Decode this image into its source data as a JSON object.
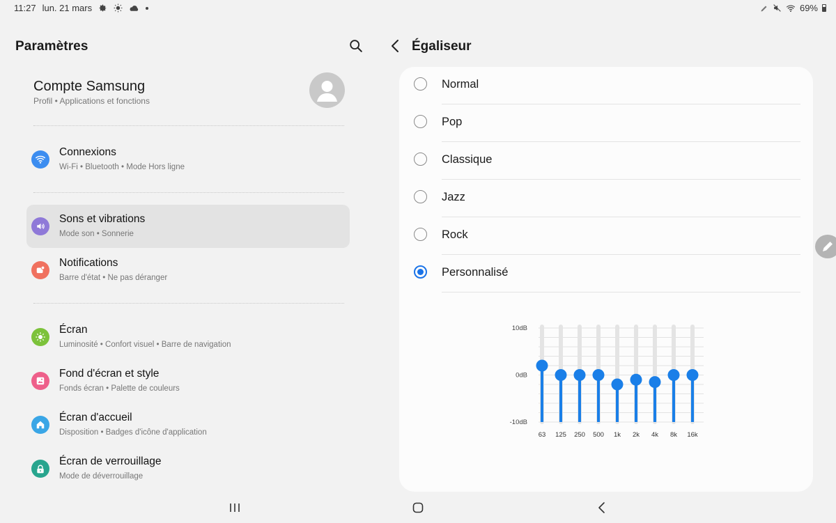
{
  "status_bar": {
    "time": "11:27",
    "date": "lun. 21 mars",
    "left_icons": [
      "gear-icon",
      "sun-icon",
      "cloud-icon",
      "dot-icon"
    ],
    "right_icons": [
      "pen-icon",
      "mute-icon",
      "wifi-icon"
    ],
    "battery": "69%"
  },
  "left": {
    "title": "Paramètres",
    "account": {
      "name": "Compte Samsung",
      "sub": "Profil  •  Applications et fonctions"
    },
    "items": [
      {
        "title": "Connexions",
        "sub": "Wi-Fi  •  Bluetooth  •  Mode Hors ligne",
        "icon": "wifi-icon",
        "color": "#3c8df0"
      },
      {
        "title": "Sons et vibrations",
        "sub": "Mode son  •  Sonnerie",
        "icon": "speaker-icon",
        "color": "#8f79d8"
      },
      {
        "title": "Notifications",
        "sub": "Barre d'état  •  Ne pas déranger",
        "icon": "notification-icon",
        "color": "#f0715f"
      },
      {
        "title": "Écran",
        "sub": "Luminosité  •  Confort visuel  •  Barre de navigation",
        "icon": "brightness-icon",
        "color": "#7cc23a"
      },
      {
        "title": "Fond d'écran et style",
        "sub": "Fonds écran  •  Palette de couleurs",
        "icon": "wallpaper-icon",
        "color": "#ee5f8a"
      },
      {
        "title": "Écran d'accueil",
        "sub": "Disposition  •  Badges d'icône d'application",
        "icon": "home-icon",
        "color": "#3aa6e6"
      },
      {
        "title": "Écran de verrouillage",
        "sub": "Mode de déverrouillage",
        "icon": "lock-icon",
        "color": "#28a58e"
      }
    ]
  },
  "right": {
    "title": "Égaliseur",
    "options": [
      {
        "label": "Normal",
        "selected": false
      },
      {
        "label": "Pop",
        "selected": false
      },
      {
        "label": "Classique",
        "selected": false
      },
      {
        "label": "Jazz",
        "selected": false
      },
      {
        "label": "Rock",
        "selected": false
      },
      {
        "label": "Personnalisé",
        "selected": true
      }
    ],
    "equalizer": {
      "y_labels": [
        "10dB",
        "0dB",
        "-10dB"
      ],
      "ylim": [
        -10,
        10
      ],
      "bands": [
        "63",
        "125",
        "250",
        "500",
        "1k",
        "2k",
        "4k",
        "8k",
        "16k"
      ],
      "gains_db": [
        2,
        0,
        0,
        0,
        -2,
        -1,
        -1.5,
        0,
        0
      ],
      "accent": "#1a7fe8"
    }
  },
  "nav": {
    "recent_icon": "recent-apps-icon",
    "home_icon": "home-button-icon",
    "back_icon": "back-icon"
  }
}
